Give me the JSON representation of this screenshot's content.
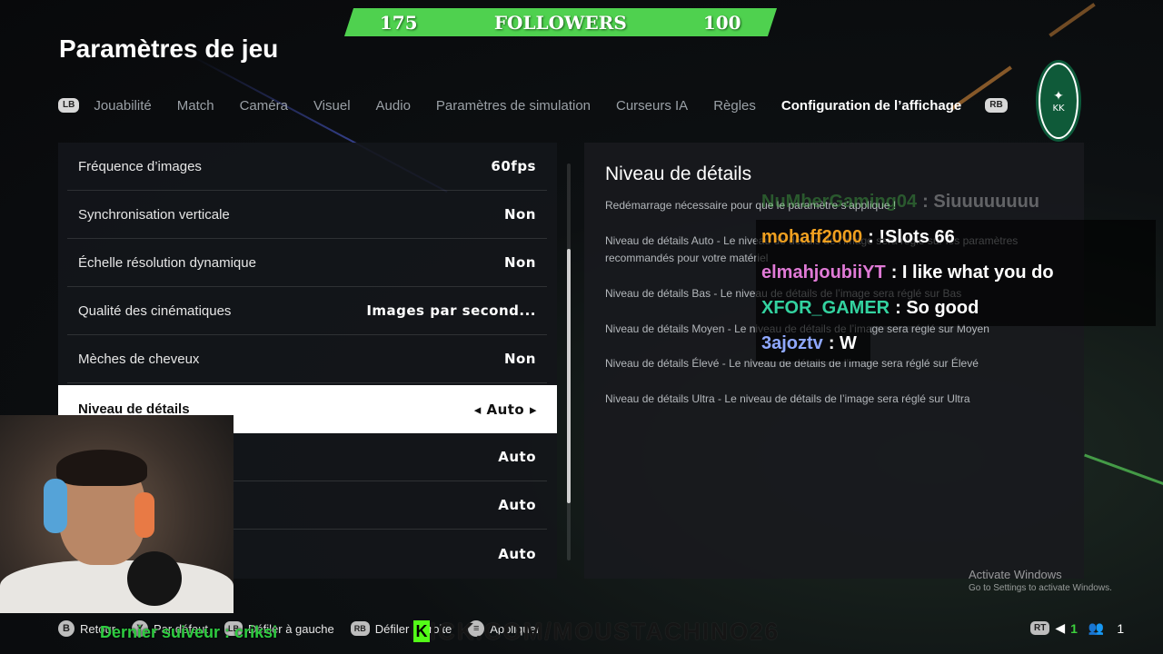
{
  "follower_goal": {
    "current": "175",
    "label": "FOLLOWERS",
    "target": "100"
  },
  "page": {
    "title": "Paramètres de jeu"
  },
  "tabs": {
    "lb": "LB",
    "rb": "RB",
    "items": [
      {
        "label": "Jouabilité"
      },
      {
        "label": "Match"
      },
      {
        "label": "Caméra"
      },
      {
        "label": "Visuel"
      },
      {
        "label": "Audio"
      },
      {
        "label": "Paramètres de simulation"
      },
      {
        "label": "Curseurs IA"
      },
      {
        "label": "Règles"
      },
      {
        "label": "Configuration de l’affichage"
      }
    ],
    "active_index": 8
  },
  "club_badge": {
    "text": "KK"
  },
  "settings": [
    {
      "label": "Fréquence d’images",
      "value": "60fps"
    },
    {
      "label": "Synchronisation verticale",
      "value": "Non"
    },
    {
      "label": "Échelle résolution dynamique",
      "value": "Non"
    },
    {
      "label": "Qualité des cinématiques",
      "value": "Images par second..."
    },
    {
      "label": "Mèches de cheveux",
      "value": "Non"
    },
    {
      "label": "Niveau de détails",
      "value": "Auto",
      "selected": true
    },
    {
      "label": "",
      "value": "Auto"
    },
    {
      "label": "",
      "value": "Auto"
    },
    {
      "label": "",
      "value": "Auto"
    }
  ],
  "description": {
    "title": "Niveau de détails",
    "restart_note": "Redémarrage nécessaire pour que le paramètre s’applique !",
    "lines": [
      "Niveau de détails Auto - Le niveau de détails de l’image sera réglé sur les paramètres recommandés pour votre matériel",
      "Niveau de détails Bas - Le niveau de détails de l’image sera réglé sur Bas",
      "Niveau de détails Moyen - Le niveau de détails de l’image sera réglé sur Moyen",
      "Niveau de détails Élevé - Le niveau de détails de l’image sera réglé sur Élevé",
      "Niveau de détails Ultra - Le niveau de détails de l’image sera réglé sur Ultra"
    ]
  },
  "chat": [
    {
      "user": "NuMberGaming04",
      "message": ": Siuuuuuuuu",
      "color": "#4fd14f",
      "faded": true
    },
    {
      "user": "mohaff2000",
      "message": ": !Slots 66",
      "color": "#f0a020"
    },
    {
      "user": "elmahjoubiiYT",
      "message": ": I like what you do",
      "color": "#e07ad6"
    },
    {
      "user": "XFOR_GAMER",
      "message": ": So good",
      "color": "#33d3a0"
    },
    {
      "user": "3ajoztv",
      "message": ": W",
      "color": "#8fa8ff"
    }
  ],
  "stream_overlay": {
    "last_follower": "Dernier suiveur : criksi",
    "kick_url": "KICK.COM/MOUSTACHINO26"
  },
  "footer": {
    "items": [
      {
        "button": "B",
        "label": "Retour"
      },
      {
        "button": "Y",
        "label": "Par défaut"
      },
      {
        "button": "LB",
        "label": "Défiler à gauche"
      },
      {
        "button": "RB",
        "label": "Défiler à droite"
      },
      {
        "button": "≡",
        "label": "Appliquer"
      }
    ]
  },
  "status": {
    "rt": "RT",
    "voice_count": "1",
    "players": "1"
  },
  "windows_watermark": {
    "line1": "Activate Windows",
    "line2": "Go to Settings to activate Windows."
  }
}
